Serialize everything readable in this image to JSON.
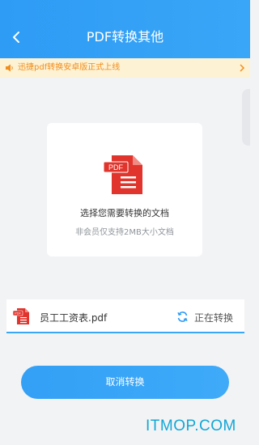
{
  "header": {
    "title": "PDF转换其他"
  },
  "notice": {
    "text": "迅捷pdf转换安卓版正式上线"
  },
  "picker": {
    "title": "选择您需要转换的文档",
    "subtitle": "非会员仅支持2MB大小文档",
    "badge": "PDF"
  },
  "file": {
    "name": "员工工资表.pdf",
    "status": "正在转换",
    "badge": "PDF"
  },
  "actions": {
    "cancel_label": "取消转换"
  },
  "watermark": "ITMOP.COM",
  "colors": {
    "primary": "#3aa6f7",
    "pdf_red": "#e0342c",
    "notice_text": "#f08d1e",
    "notice_bg": "#fdf2d4"
  },
  "icons": {
    "back": "chevron-left",
    "notice": "speaker",
    "refresh": "refresh-arrows",
    "file": "pdf-document"
  }
}
